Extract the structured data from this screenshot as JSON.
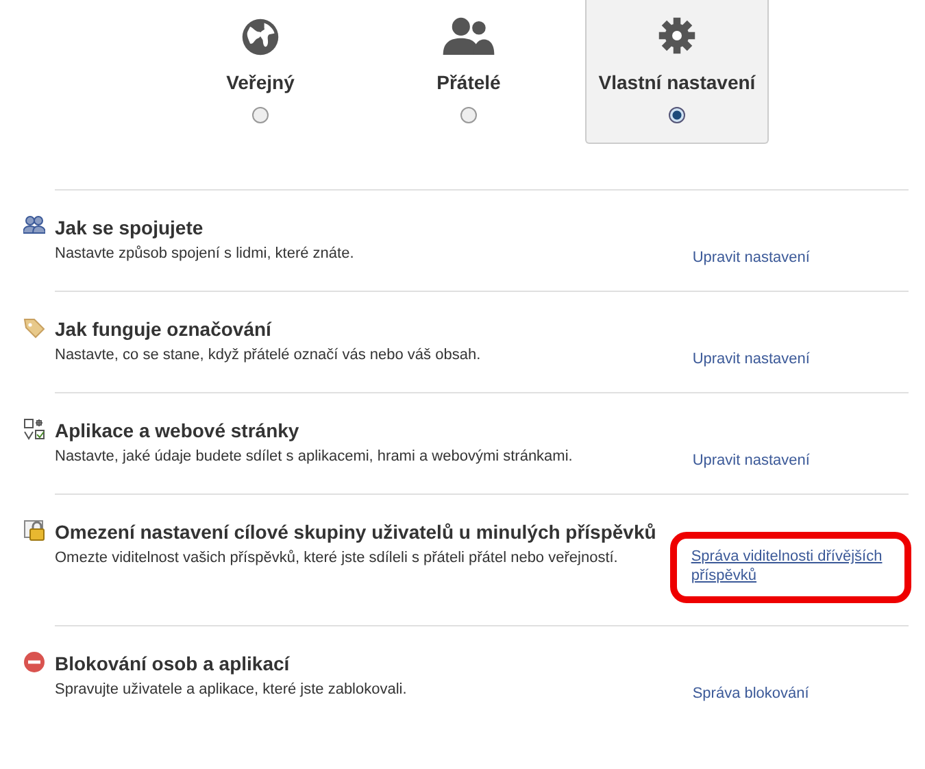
{
  "audience_options": [
    {
      "label": "Veřejný",
      "selected": false
    },
    {
      "label": "Přátelé",
      "selected": false
    },
    {
      "label": "Vlastní nastavení",
      "selected": true
    }
  ],
  "settings": [
    {
      "title": "Jak se spojujete",
      "description": "Nastavte způsob spojení s lidmi, které znáte.",
      "link": "Upravit nastavení",
      "highlighted": false
    },
    {
      "title": "Jak funguje označování",
      "description": "Nastavte, co se stane, když přátelé označí vás nebo váš obsah.",
      "link": "Upravit nastavení",
      "highlighted": false
    },
    {
      "title": "Aplikace a webové stránky",
      "description": "Nastavte, jaké údaje budete sdílet s aplikacemi, hrami a webovými stránkami.",
      "link": "Upravit nastavení",
      "highlighted": false
    },
    {
      "title": "Omezení nastavení cílové skupiny uživatelů u minulých příspěvků",
      "description": "Omezte viditelnost vašich příspěvků, které jste sdíleli s přáteli přátel nebo veřejností.",
      "link": "Správa viditelnosti dřívějších příspěvků",
      "highlighted": true
    },
    {
      "title": "Blokování osob a aplikací",
      "description": "Spravujte uživatele a aplikace, které jste zablokovali.",
      "link": "Správa blokování",
      "highlighted": false
    }
  ]
}
